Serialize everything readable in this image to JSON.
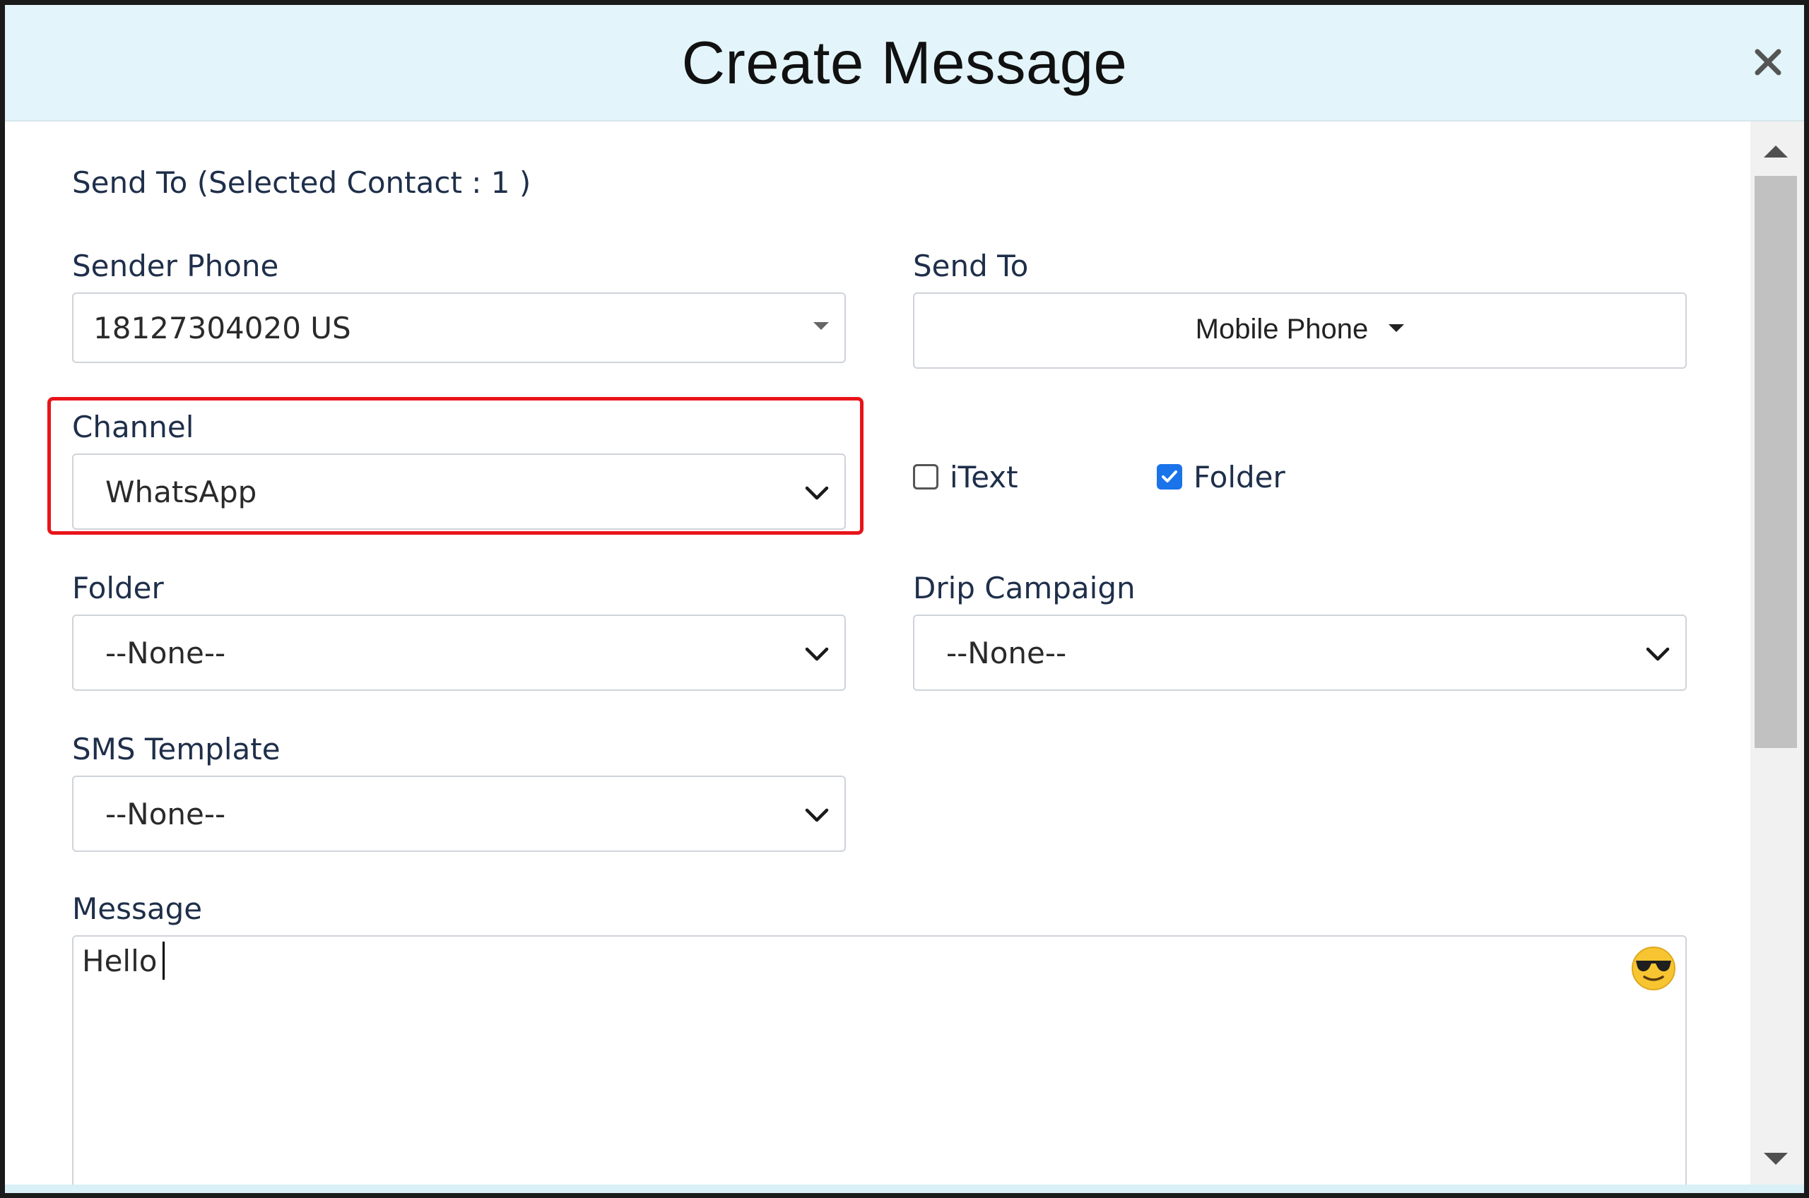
{
  "dialog": {
    "title": "Create Message",
    "close_icon": "close-icon"
  },
  "send_to_summary": "Send To (Selected Contact : 1 )",
  "sender_phone": {
    "label": "Sender Phone",
    "value": "18127304020 US"
  },
  "send_to": {
    "label": "Send To",
    "value": "Mobile Phone"
  },
  "channel": {
    "label": "Channel",
    "value": "WhatsApp",
    "highlight_color": "#e8141a"
  },
  "options": {
    "itext": {
      "label": "iText",
      "checked": false
    },
    "folder": {
      "label": "Folder",
      "checked": true,
      "color": "#1a73e8"
    }
  },
  "folder": {
    "label": "Folder",
    "value": "--None--"
  },
  "drip_campaign": {
    "label": "Drip Campaign",
    "value": "--None--"
  },
  "sms_template": {
    "label": "SMS Template",
    "value": "--None--"
  },
  "message": {
    "label": "Message",
    "value": "Hello",
    "emoji_icon": "sunglasses-emoji-icon"
  },
  "colors": {
    "header_bg": "#e3f5fa",
    "label_text": "#1f2f4a"
  }
}
